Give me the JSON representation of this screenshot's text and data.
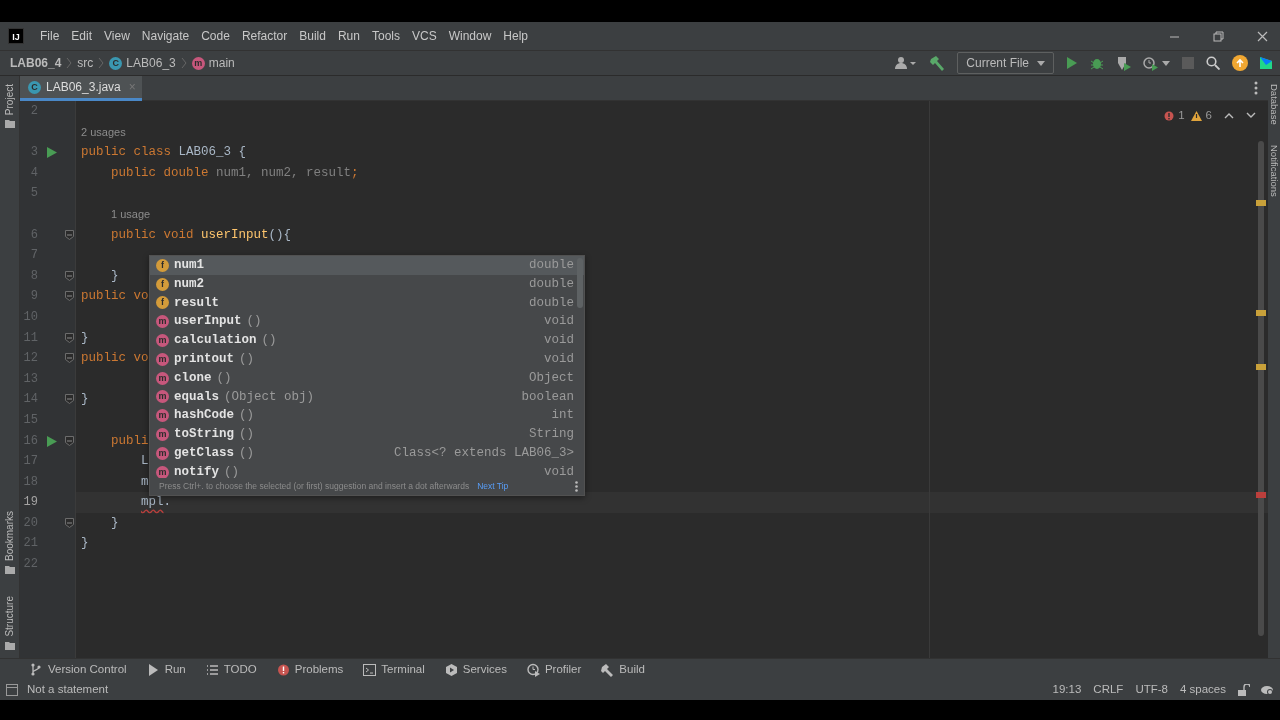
{
  "title_bar": {
    "logo": "IJ",
    "menus": [
      "File",
      "Edit",
      "View",
      "Navigate",
      "Code",
      "Refactor",
      "Build",
      "Run",
      "Tools",
      "VCS",
      "Window",
      "Help"
    ]
  },
  "breadcrumbs": [
    {
      "label": "LAB06_4",
      "kind": "project"
    },
    {
      "label": "src",
      "kind": "folder"
    },
    {
      "label": "LAB06_3",
      "kind": "class",
      "badge": "C"
    },
    {
      "label": "main",
      "kind": "method",
      "badge": "m"
    }
  ],
  "toolbar": {
    "run_config": "Current File",
    "stop_disabled": true
  },
  "tabs": [
    {
      "label": "LAB06_3.java",
      "badge": "C",
      "close": "×",
      "selected": true
    }
  ],
  "inspections": {
    "errors": "1",
    "warnings": "6"
  },
  "left_tool_strip": [
    {
      "label": "Project",
      "kind": "top"
    },
    {
      "label": "Bookmarks",
      "kind": "bottom"
    },
    {
      "label": "Structure",
      "kind": "bottom"
    }
  ],
  "right_tool_strip": [
    "Database",
    "Notifications"
  ],
  "editor": {
    "lines": [
      {
        "kind": "code",
        "number": "2"
      },
      {
        "kind": "hint",
        "text": "2 usages"
      },
      {
        "kind": "code",
        "number": "3",
        "run": true,
        "tokens": [
          {
            "t": "public class ",
            "kind": "keyword"
          },
          {
            "t": "LAB06_3 {",
            "kind": "plain"
          }
        ]
      },
      {
        "kind": "code",
        "number": "4",
        "tokens": [
          {
            "t": "    public double ",
            "kind": "keyword"
          },
          {
            "t": "num1, num2, result",
            "kind": "unused"
          },
          {
            "t": ";",
            "kind": "keyword"
          }
        ]
      },
      {
        "kind": "code",
        "number": "5"
      },
      {
        "kind": "hint",
        "text": "1 usage"
      },
      {
        "kind": "code",
        "number": "6",
        "fold": true,
        "tokens": [
          {
            "t": "    public void ",
            "kind": "keyword"
          },
          {
            "t": "userInput",
            "kind": "method"
          },
          {
            "t": "(){",
            "kind": "plain"
          }
        ]
      },
      {
        "kind": "code",
        "number": "7"
      },
      {
        "kind": "code",
        "number": "8",
        "fold": true,
        "tokens": [
          {
            "t": "    }",
            "kind": "plain"
          }
        ]
      },
      {
        "kind": "code",
        "number": "9",
        "fold": true,
        "tokens": [
          {
            "t": "public vo",
            "kind": "keyword"
          }
        ]
      },
      {
        "kind": "code",
        "number": "10"
      },
      {
        "kind": "code",
        "number": "11",
        "fold": true,
        "tokens": [
          {
            "t": "}",
            "kind": "plain"
          }
        ]
      },
      {
        "kind": "code",
        "number": "12",
        "fold": true,
        "tokens": [
          {
            "t": "public vo",
            "kind": "keyword"
          }
        ]
      },
      {
        "kind": "code",
        "number": "13"
      },
      {
        "kind": "code",
        "number": "14",
        "fold": true,
        "tokens": [
          {
            "t": "}",
            "kind": "plain"
          }
        ]
      },
      {
        "kind": "code",
        "number": "15"
      },
      {
        "kind": "code",
        "number": "16",
        "run": true,
        "fold": true,
        "tokens": [
          {
            "t": "    publi",
            "kind": "keyword"
          }
        ]
      },
      {
        "kind": "code",
        "number": "17",
        "tokens": [
          {
            "t": "        L",
            "kind": "plain"
          }
        ]
      },
      {
        "kind": "code",
        "number": "18",
        "tokens": [
          {
            "t": "        m",
            "kind": "plain"
          }
        ]
      },
      {
        "kind": "code",
        "number": "19",
        "current": true,
        "tokens": [
          {
            "t": "        mpl",
            "kind": "error"
          },
          {
            "t": ".",
            "kind": "plain"
          }
        ]
      },
      {
        "kind": "code",
        "number": "20",
        "fold": true,
        "tokens": [
          {
            "t": "    }",
            "kind": "plain"
          }
        ]
      },
      {
        "kind": "code",
        "number": "21",
        "tokens": [
          {
            "t": "}",
            "kind": "plain"
          }
        ]
      },
      {
        "kind": "code",
        "number": "22"
      }
    ]
  },
  "completion": {
    "items": [
      {
        "kind": "field",
        "badge": "f",
        "name": "num1",
        "type": "double",
        "selected": true
      },
      {
        "kind": "field",
        "badge": "f",
        "name": "num2",
        "type": "double",
        "selected": false
      },
      {
        "kind": "field",
        "badge": "f",
        "name": "result",
        "type": "double",
        "selected": false
      },
      {
        "kind": "method",
        "badge": "m",
        "name": "userInput",
        "params": "()",
        "type": "void",
        "selected": false
      },
      {
        "kind": "method",
        "badge": "m",
        "name": "calculation",
        "params": "()",
        "type": "void",
        "selected": false
      },
      {
        "kind": "method",
        "badge": "m",
        "name": "printout",
        "params": "()",
        "type": "void",
        "selected": false
      },
      {
        "kind": "method",
        "badge": "m",
        "name": "clone",
        "params": "()",
        "type": "Object",
        "selected": false
      },
      {
        "kind": "method",
        "badge": "m",
        "name": "equals",
        "params": "(Object obj)",
        "type": "boolean",
        "selected": false
      },
      {
        "kind": "method",
        "badge": "m",
        "name": "hashCode",
        "params": "()",
        "type": "int",
        "selected": false
      },
      {
        "kind": "method",
        "badge": "m",
        "name": "toString",
        "params": "()",
        "type": "String",
        "selected": false
      },
      {
        "kind": "method",
        "badge": "m",
        "name": "getClass",
        "params": "()",
        "type": "Class<? extends LAB06_3>",
        "selected": false
      },
      {
        "kind": "method",
        "badge": "m",
        "name": "notify",
        "params": "()",
        "type": "void",
        "selected": false
      }
    ],
    "hint": "Press Ctrl+. to choose the selected (or first) suggestion and insert a dot afterwards",
    "next_tip": "Next Tip"
  },
  "tool_windows": [
    {
      "label": "Version Control",
      "kind": "vcs"
    },
    {
      "label": "Run",
      "kind": "run"
    },
    {
      "label": "TODO",
      "kind": "todo"
    },
    {
      "label": "Problems",
      "kind": "problems"
    },
    {
      "label": "Terminal",
      "kind": "terminal"
    },
    {
      "label": "Services",
      "kind": "services"
    },
    {
      "label": "Profiler",
      "kind": "profiler"
    },
    {
      "label": "Build",
      "kind": "build"
    }
  ],
  "status_bar": {
    "message": "Not a statement",
    "items": [
      "19:13",
      "CRLF",
      "UTF-8",
      "4 spaces"
    ]
  }
}
